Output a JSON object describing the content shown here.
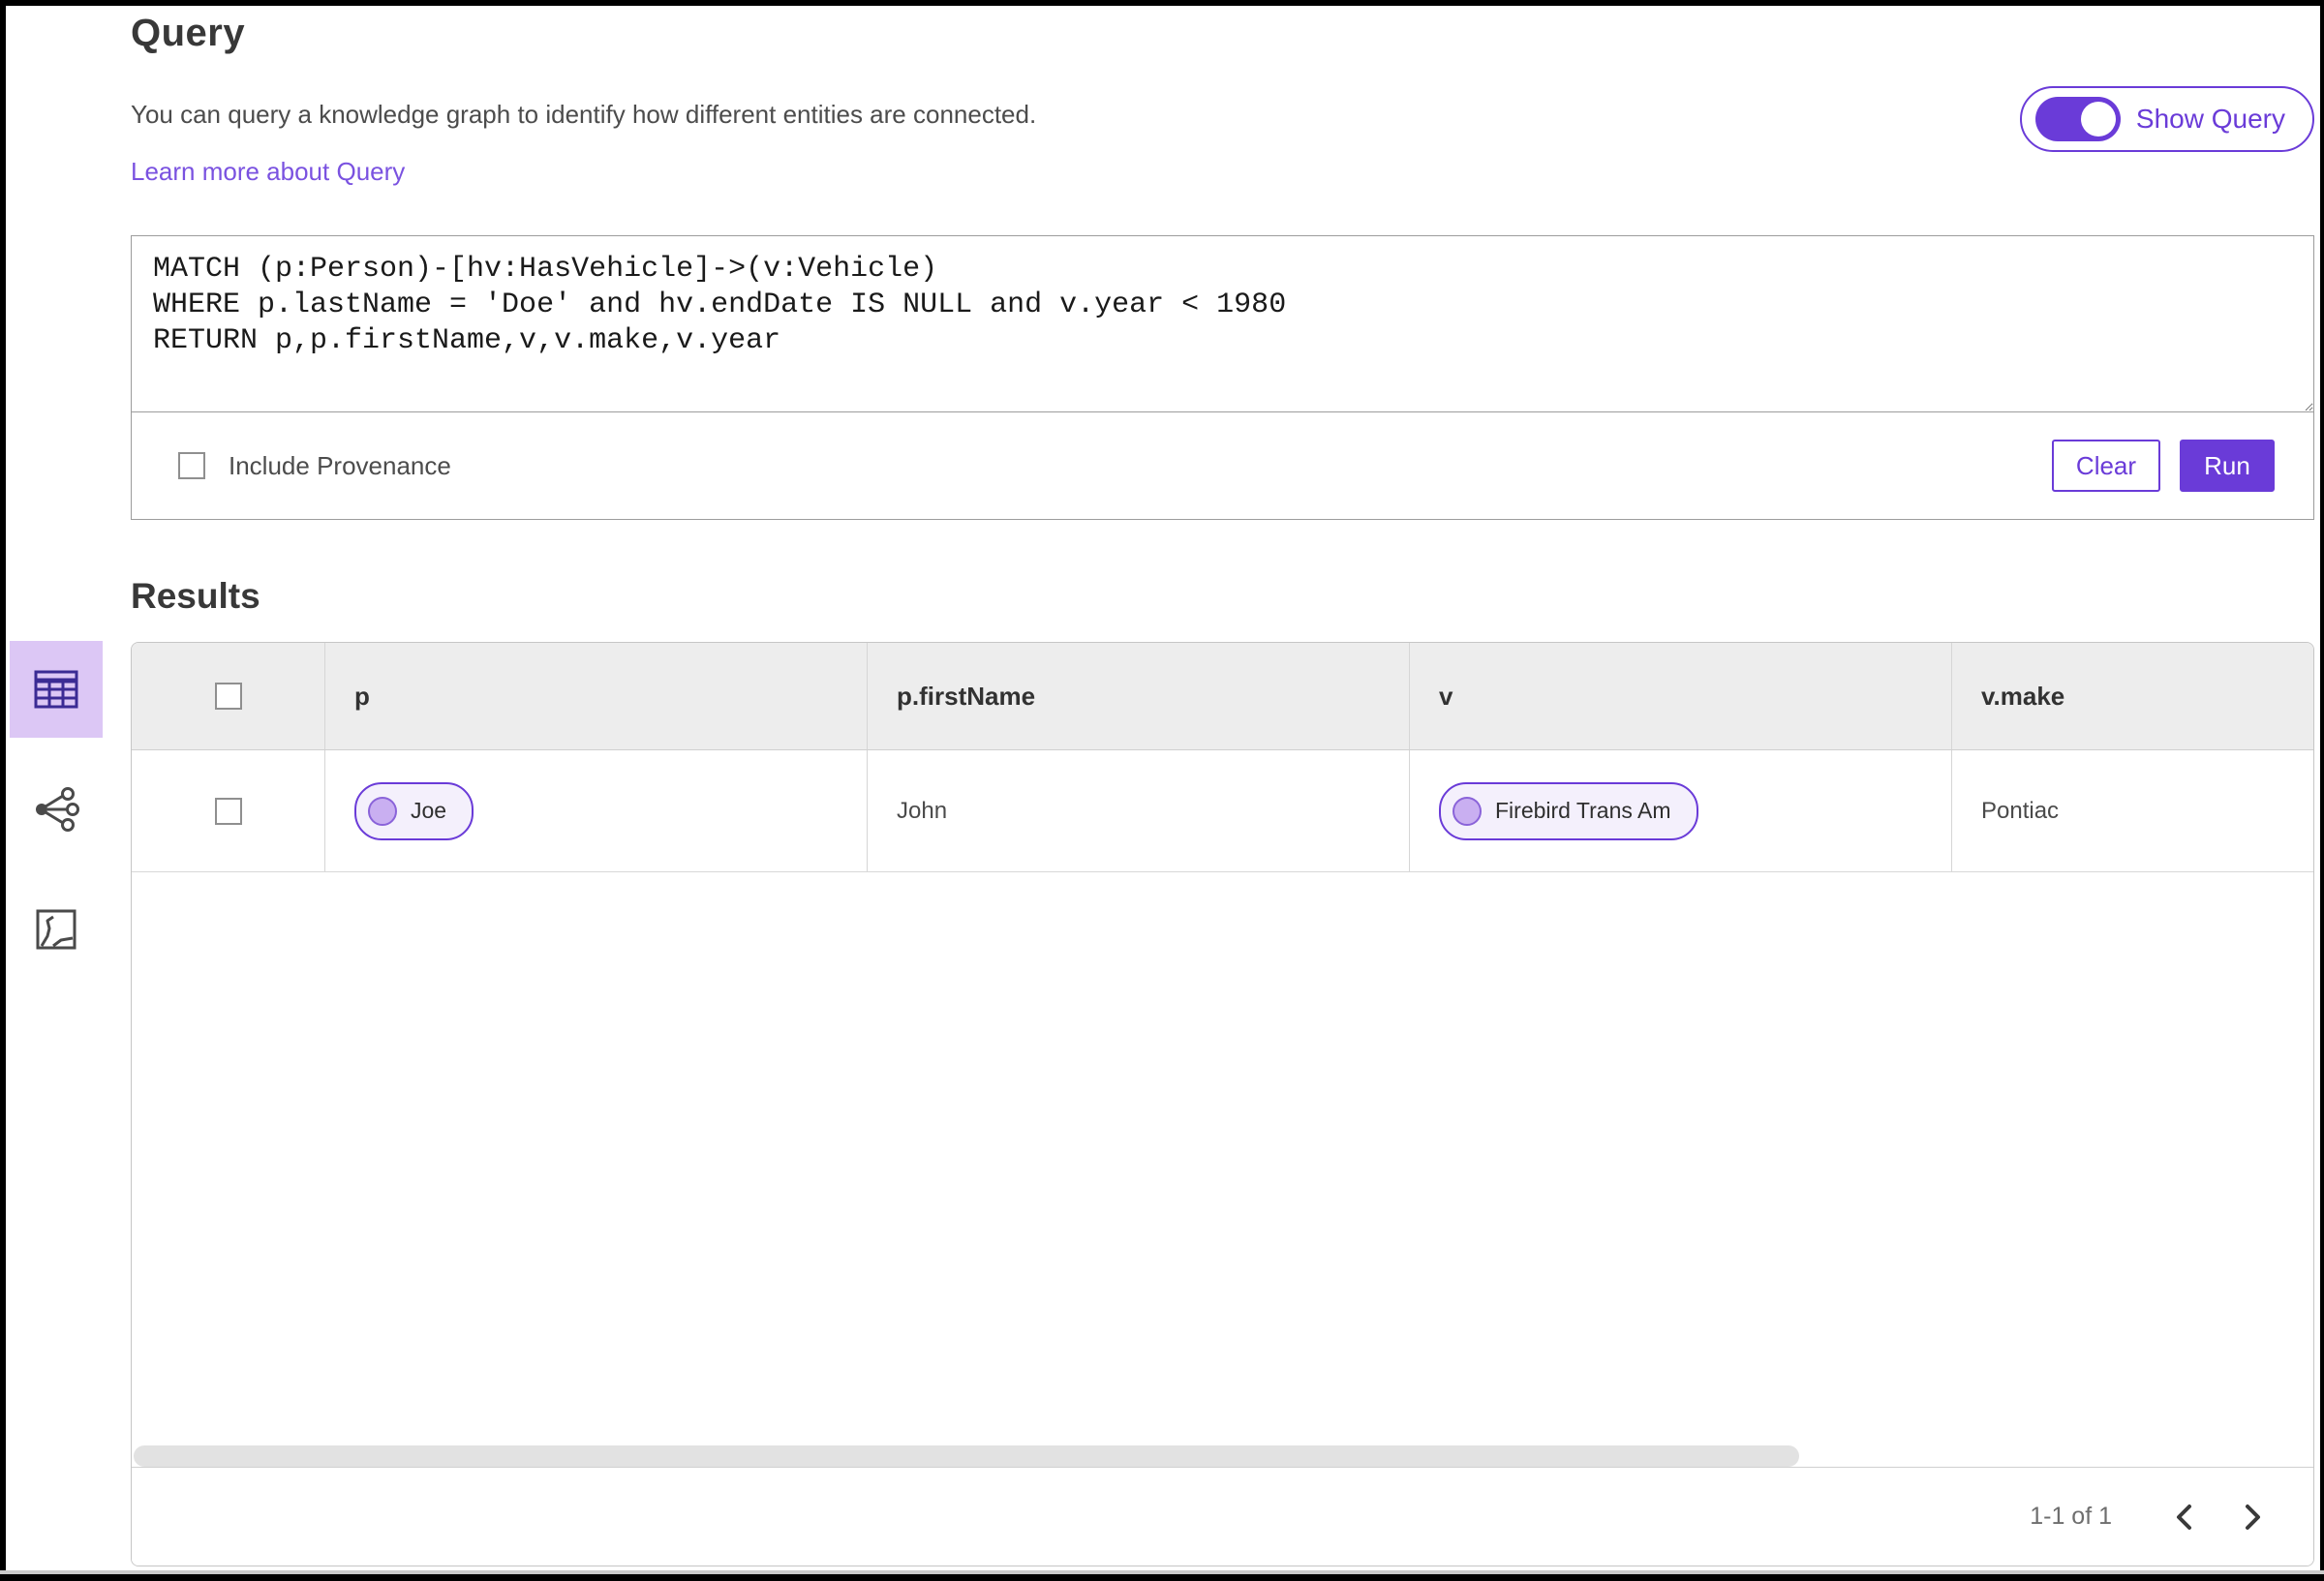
{
  "colors": {
    "accent": "#6a3bd8",
    "selected_view_bg": "#dcc7f5",
    "pill_bg": "#f4f0fc",
    "header_row_bg": "#ededed"
  },
  "header": {
    "title": "Query",
    "description": "You can query a knowledge graph to identify how different entities are connected.",
    "learn_more_label": "Learn more about Query",
    "show_query_label": "Show Query",
    "show_query_state": "on"
  },
  "query": {
    "code": "MATCH (p:Person)-[hv:HasVehicle]->(v:Vehicle)\nWHERE p.lastName = 'Doe' and hv.endDate IS NULL and v.year < 1980\nRETURN p,p.firstName,v,v.make,v.year",
    "include_provenance_label": "Include Provenance",
    "include_provenance_checked": false,
    "clear_label": "Clear",
    "run_label": "Run"
  },
  "results": {
    "heading": "Results",
    "views": [
      {
        "name": "table-view",
        "selected": true
      },
      {
        "name": "link-chart-view",
        "selected": false
      },
      {
        "name": "map-view",
        "selected": false
      }
    ],
    "columns": [
      "p",
      "p.firstName",
      "v",
      "v.make"
    ],
    "rows": [
      {
        "p_badge": "Joe",
        "p_firstName": "John",
        "v_badge": "Firebird Trans Am",
        "v_make": "Pontiac",
        "checked": false
      }
    ],
    "pagination": {
      "range_label": "1-1 of 1"
    }
  }
}
